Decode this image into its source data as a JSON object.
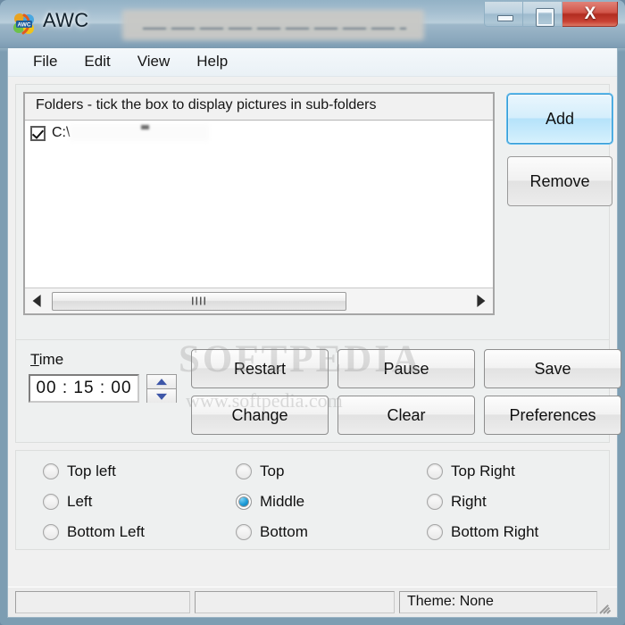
{
  "window": {
    "title": "AWC",
    "icon": "awc-app-icon",
    "title_redacted": true,
    "controls": {
      "minimize": "minimize-icon",
      "maximize": "restore-icon",
      "close_glyph": "X"
    },
    "colors": {
      "close_button": "#b22d21",
      "accent_blue": "#1a9ad6",
      "focus_border": "#3c9cd4",
      "frame_glass": "#8fb0c4",
      "client_background": "#f0f0f0"
    }
  },
  "menu": {
    "items": [
      {
        "label": "File"
      },
      {
        "label": "Edit"
      },
      {
        "label": "View"
      },
      {
        "label": "Help"
      }
    ]
  },
  "folders": {
    "header": "Folders - tick the box to display pictures in sub-folders",
    "rows": [
      {
        "checked": true,
        "path": "C:\\",
        "redacted": true
      }
    ],
    "scrollbar": {
      "left_arrow": "scroll-left-icon",
      "right_arrow": "scroll-right-icon",
      "thumb_grip": "scrollbar-grip"
    },
    "buttons": {
      "add": "Add",
      "remove": "Remove"
    }
  },
  "actions": {
    "time_label": "Time",
    "time_accel": "T",
    "time_label_rest": "ime",
    "time_value": "00 : 15 : 00",
    "spinner": {
      "up": "spinner-up-icon",
      "down": "spinner-down-icon"
    },
    "buttons": [
      {
        "label": "Restart"
      },
      {
        "label": "Pause"
      },
      {
        "label": "Save"
      },
      {
        "label": "Change"
      },
      {
        "label": "Clear"
      },
      {
        "label": "Preferences"
      }
    ]
  },
  "position": {
    "options": [
      {
        "label": "Top left",
        "selected": false,
        "col": 1,
        "row": 1
      },
      {
        "label": "Left",
        "selected": false,
        "col": 1,
        "row": 2
      },
      {
        "label": "Bottom Left",
        "selected": false,
        "col": 1,
        "row": 3
      },
      {
        "label": "Top",
        "selected": false,
        "col": 2,
        "row": 1
      },
      {
        "label": "Middle",
        "selected": true,
        "col": 2,
        "row": 2
      },
      {
        "label": "Bottom",
        "selected": false,
        "col": 2,
        "row": 3
      },
      {
        "label": "Top Right",
        "selected": false,
        "col": 3,
        "row": 1
      },
      {
        "label": "Right",
        "selected": false,
        "col": 3,
        "row": 2
      },
      {
        "label": "Bottom Right",
        "selected": false,
        "col": 3,
        "row": 3
      }
    ]
  },
  "status_bar": {
    "pane1": "",
    "pane2": "",
    "pane3": "Theme: None",
    "resize_grip": "resize-grip-icon"
  },
  "watermark": {
    "main": "SOFTPEDIA",
    "sub": "www.softpedia.com"
  }
}
